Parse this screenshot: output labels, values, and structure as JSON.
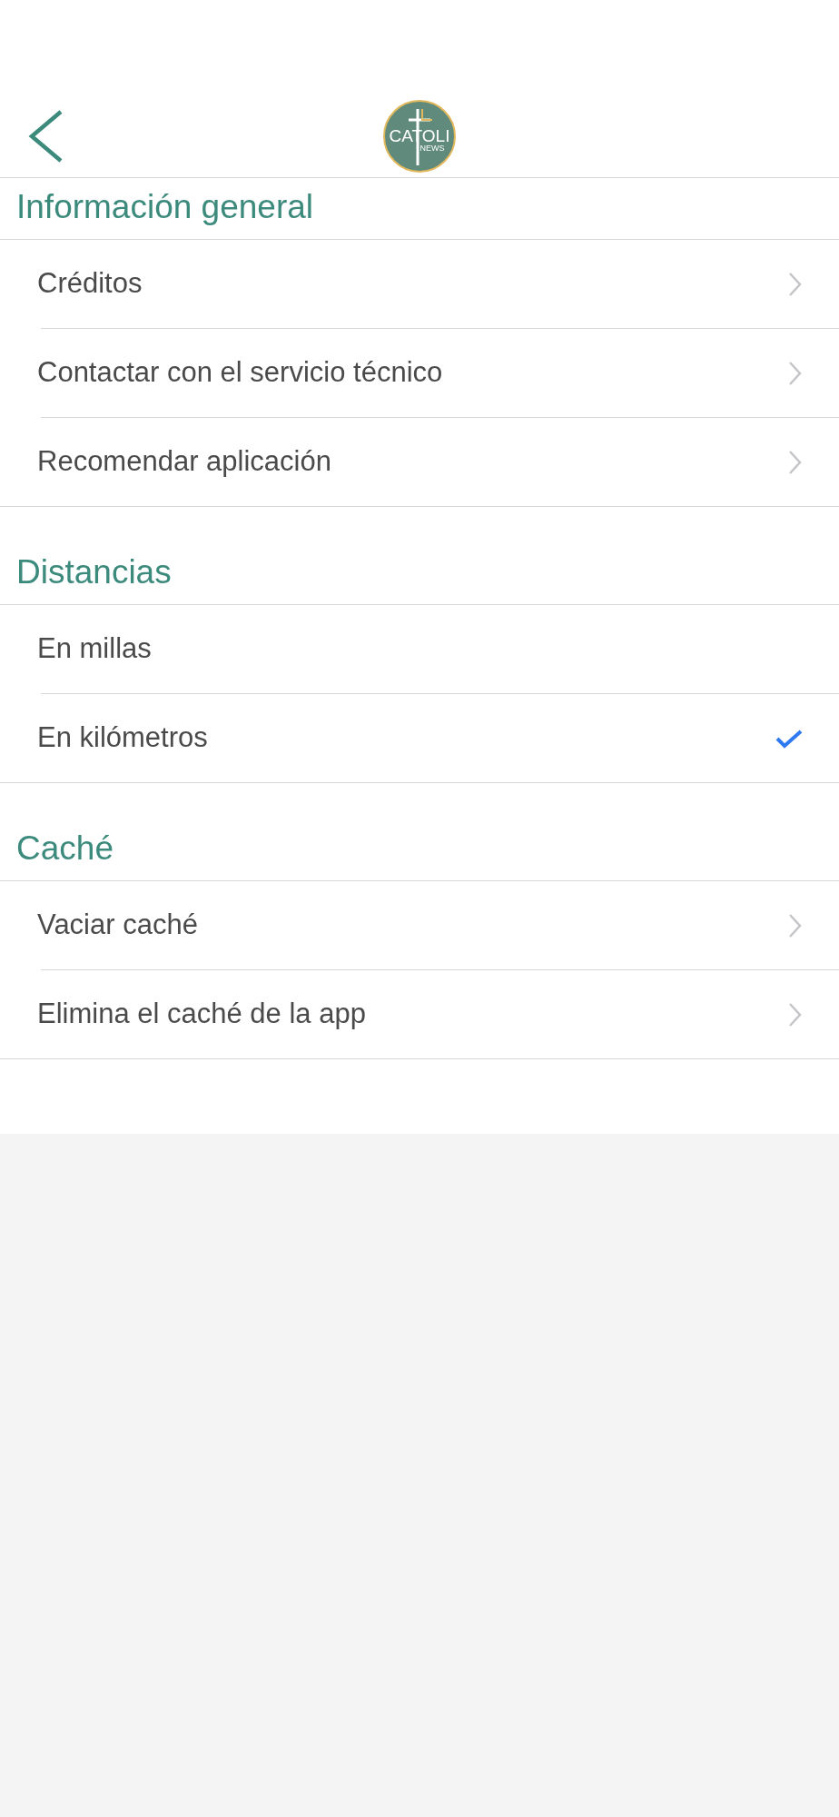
{
  "header": {
    "logo": {
      "title": "CATOLI",
      "subtitle": "NEWS"
    }
  },
  "sections": [
    {
      "title": "Información general",
      "items": [
        {
          "kind": "link",
          "label": "Créditos"
        },
        {
          "kind": "link",
          "label": "Contactar con el servicio técnico"
        },
        {
          "kind": "link",
          "label": "Recomendar aplicación"
        }
      ]
    },
    {
      "title": "Distancias",
      "items": [
        {
          "kind": "option",
          "label": "En millas",
          "selected": false
        },
        {
          "kind": "option",
          "label": "En kilómetros",
          "selected": true
        }
      ]
    },
    {
      "title": "Caché",
      "items": [
        {
          "kind": "link",
          "label": "Vaciar caché"
        },
        {
          "kind": "link",
          "label": "Elimina el caché de la app"
        }
      ]
    }
  ]
}
